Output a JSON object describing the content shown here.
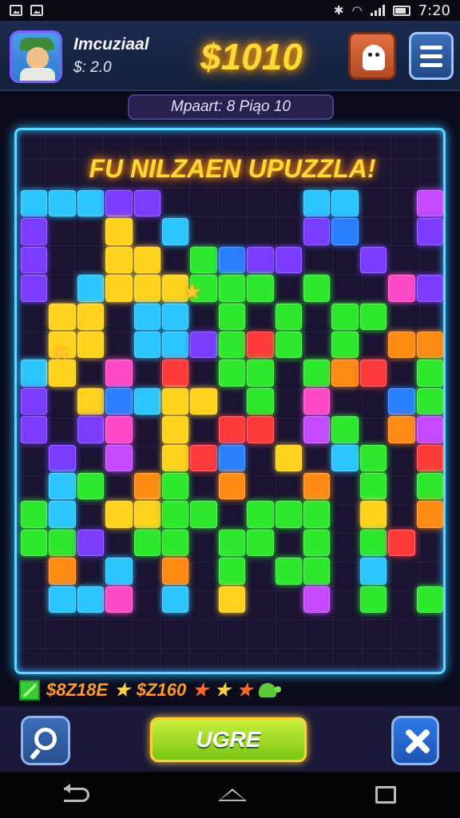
{
  "status_bar": {
    "time": "7:20"
  },
  "header": {
    "player_name": "Imcuziaal",
    "player_sub": "$: 2.0",
    "score": "$1010",
    "avatar_icon": "player-avatar",
    "shop_icon": "ghost-shop-icon",
    "menu_icon": "hamburger-menu-icon"
  },
  "level_banner": "Mpaart: 8 Piąo 10",
  "board": {
    "title": "FU NILZAEN UPUZZLA!",
    "palette": [
      "#2bc6ff",
      "#7a3cff",
      "#c54aff",
      "#ffd21e",
      "#2ee82e",
      "#ff8a14",
      "#ff3a3a",
      "#ff4ac8",
      "#2a7fff"
    ],
    "star_color": "#ffc830"
  },
  "stats": {
    "value_a": "$8Z18E",
    "value_b": "$Z160",
    "star_colors": [
      "#ffd23a",
      "#ff6a20",
      "#ffd23a",
      "#ff6a20"
    ]
  },
  "controls": {
    "main_button": "UGRE",
    "zoom_icon": "magnifier-icon",
    "close_icon": "close-x-icon",
    "main_color": "#9ad82a"
  },
  "nav": {
    "back": "back-icon",
    "home": "home-icon",
    "recent": "recent-apps-icon"
  }
}
